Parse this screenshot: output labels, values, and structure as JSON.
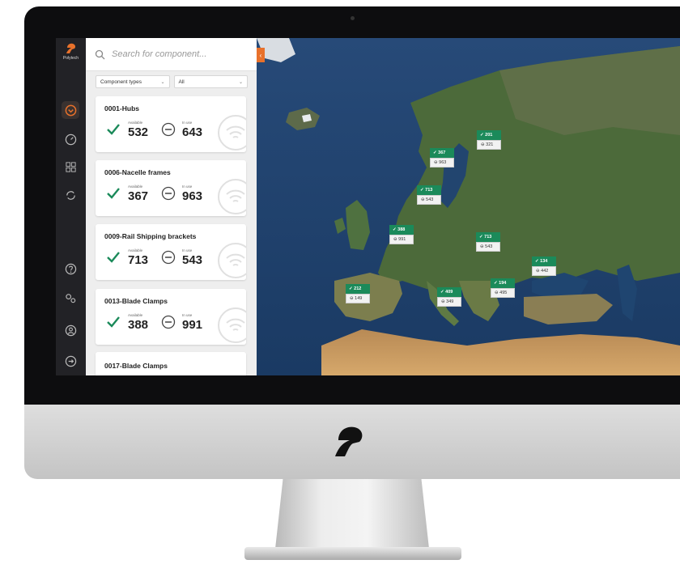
{
  "app": {
    "brand": "Polytech"
  },
  "search": {
    "placeholder": "Search for component..."
  },
  "filters": {
    "type_label": "Component types",
    "value_label": "All"
  },
  "components": [
    {
      "name": "0001-Hubs",
      "available_label": "Available",
      "available": "532",
      "in_use_label": "In use",
      "in_use": "643"
    },
    {
      "name": "0006-Nacelle frames",
      "available_label": "Available",
      "available": "367",
      "in_use_label": "In use",
      "in_use": "963"
    },
    {
      "name": "0009-Rail Shipping brackets",
      "available_label": "Available",
      "available": "713",
      "in_use_label": "In use",
      "in_use": "543"
    },
    {
      "name": "0013-Blade Clamps",
      "available_label": "Available",
      "available": "388",
      "in_use_label": "In use",
      "in_use": "991"
    },
    {
      "name": "0017-Blade Clamps"
    }
  ],
  "map_markers": [
    {
      "available": "✓ 201",
      "in_use": "⊖ 321"
    },
    {
      "available": "✓ 367",
      "in_use": "⊖ 963"
    },
    {
      "available": "✓ 713",
      "in_use": "⊖ 543"
    },
    {
      "available": "✓ 388",
      "in_use": "⊖ 991"
    },
    {
      "available": "✓ 713",
      "in_use": "⊖ 543"
    },
    {
      "available": "✓ 134",
      "in_use": "⊖ 442"
    },
    {
      "available": "✓ 212",
      "in_use": "⊖ 149"
    },
    {
      "available": "✓ 409",
      "in_use": "⊖ 349"
    },
    {
      "available": "✓ 194",
      "in_use": "⊖ 495"
    }
  ],
  "colors": {
    "accent": "#e8712b",
    "available_green": "#1b8a5a",
    "sidebar": "#222226"
  },
  "icons": [
    "logo-icon",
    "dashboard-icon",
    "gauge-icon",
    "grid-icon",
    "sync-icon",
    "help-icon",
    "settings-icon",
    "user-icon",
    "logout-icon",
    "search-icon",
    "check-icon",
    "minus-circle-icon",
    "wifi-icon"
  ]
}
